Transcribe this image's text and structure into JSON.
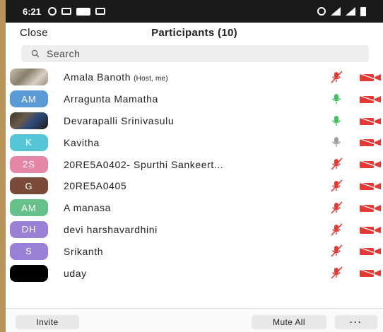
{
  "status_bar": {
    "time": "6:21"
  },
  "header": {
    "close_label": "Close",
    "title": "Participants (10)"
  },
  "search": {
    "placeholder": "Search"
  },
  "participants": [
    {
      "name": "Amala Banoth",
      "tag": "(Host, me)",
      "avatar": "photo",
      "mic": "muted",
      "camera": "off"
    },
    {
      "name": "Arragunta Mamatha",
      "initials": "AM",
      "avatar_color": "#5b9bd5",
      "mic": "active",
      "camera": "off"
    },
    {
      "name": "Devarapalli Srinivasulu",
      "avatar": "photo",
      "mic": "active",
      "camera": "off"
    },
    {
      "name": "Kavitha",
      "initials": "K",
      "avatar_color": "#55c6d6",
      "mic": "unmuted",
      "camera": "off"
    },
    {
      "name": "20RE5A0402- Spurthi Sankeert...",
      "initials": "2S",
      "avatar_color": "#e586a8",
      "mic": "muted",
      "camera": "off"
    },
    {
      "name": "20RE5A0405",
      "initials": "G",
      "avatar_color": "#7a4a3a",
      "mic": "muted",
      "camera": "off"
    },
    {
      "name": "A manasa",
      "initials": "AM",
      "avatar_color": "#66c08a",
      "mic": "muted",
      "camera": "off"
    },
    {
      "name": "devi harshavardhini",
      "initials": "DH",
      "avatar_color": "#9a80d6",
      "mic": "muted",
      "camera": "off"
    },
    {
      "name": "Srikanth",
      "initials": "S",
      "avatar_color": "#9a80d6",
      "mic": "muted",
      "camera": "off"
    },
    {
      "name": "uday",
      "avatar": "photo-dark",
      "mic": "muted",
      "camera": "off"
    }
  ],
  "footer": {
    "invite_label": "Invite",
    "mute_all_label": "Mute All",
    "more_label": "···"
  },
  "colors": {
    "muted_red": "#e53935",
    "active_green": "#43c15a",
    "neutral_gray": "#9e9e9e"
  }
}
